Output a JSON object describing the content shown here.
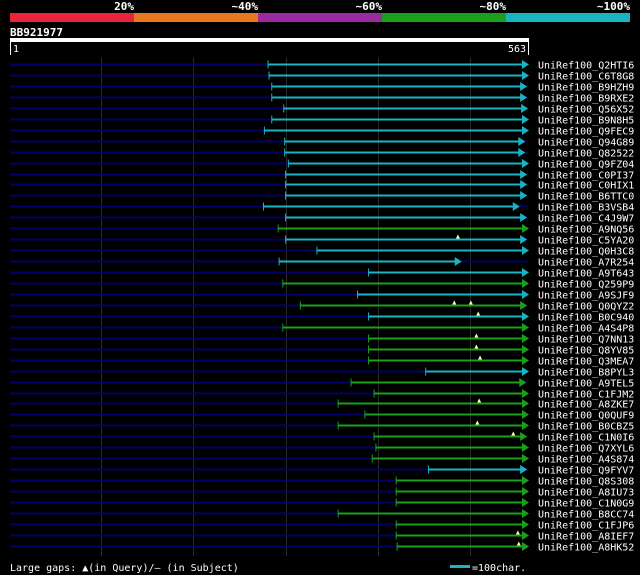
{
  "scale_labels": [
    "20%",
    "~40%",
    "~60%",
    "~80%",
    "~100%"
  ],
  "scale_colors": [
    "#e8243c",
    "#e8781e",
    "#9b2aa0",
    "#1aa01a",
    "#18b4c4"
  ],
  "query_name": "BB921977",
  "query_start": "1",
  "query_end": "563",
  "legend": {
    "gaps_text": "Large gaps: ▲(in Query)/– (in Subject)",
    "scale_text": "=100char."
  },
  "chart_data": {
    "type": "bar",
    "query_length": 563,
    "hits": [
      {
        "name": "UniRef100_Q2HTI6",
        "start": 281,
        "end": 563,
        "color": "#18b4c4",
        "query_gaps": []
      },
      {
        "name": "UniRef100_C6T8G8",
        "start": 282,
        "end": 563,
        "color": "#18b4c4",
        "query_gaps": []
      },
      {
        "name": "UniRef100_B9HZH9",
        "start": 285,
        "end": 561,
        "color": "#18b4c4",
        "query_gaps": []
      },
      {
        "name": "UniRef100_B9RXE2",
        "start": 285,
        "end": 561,
        "color": "#18b4c4",
        "query_gaps": []
      },
      {
        "name": "UniRef100_Q56X52",
        "start": 298,
        "end": 562,
        "color": "#18b4c4",
        "query_gaps": []
      },
      {
        "name": "UniRef100_B9N8H5",
        "start": 285,
        "end": 563,
        "color": "#18b4c4",
        "query_gaps": []
      },
      {
        "name": "UniRef100_Q9FEC9",
        "start": 277,
        "end": 563,
        "color": "#18b4c4",
        "query_gaps": []
      },
      {
        "name": "UniRef100_Q94G89",
        "start": 299,
        "end": 559,
        "color": "#18b4c4",
        "query_gaps": []
      },
      {
        "name": "UniRef100_Q82522",
        "start": 299,
        "end": 559,
        "color": "#18b4c4",
        "query_gaps": []
      },
      {
        "name": "UniRef100_Q9FZ04",
        "start": 303,
        "end": 563,
        "color": "#18b4c4",
        "query_gaps": []
      },
      {
        "name": "UniRef100_C0PI37",
        "start": 300,
        "end": 561,
        "color": "#18b4c4",
        "query_gaps": []
      },
      {
        "name": "UniRef100_C0HIX1",
        "start": 300,
        "end": 561,
        "color": "#18b4c4",
        "query_gaps": []
      },
      {
        "name": "UniRef100_B6TTC0",
        "start": 300,
        "end": 561,
        "color": "#18b4c4",
        "query_gaps": []
      },
      {
        "name": "UniRef100_B3VSB4",
        "start": 276,
        "end": 553,
        "color": "#18b4c4",
        "query_gaps": []
      },
      {
        "name": "UniRef100_C4J9W7",
        "start": 300,
        "end": 561,
        "color": "#18b4c4",
        "query_gaps": []
      },
      {
        "name": "UniRef100_A9NQ56",
        "start": 292,
        "end": 563,
        "color": "#1aa01a",
        "query_gaps": []
      },
      {
        "name": "UniRef100_C5YA20",
        "start": 300,
        "end": 561,
        "color": "#18b4c4",
        "query_gaps": [
          487
        ]
      },
      {
        "name": "UniRef100_Q0H3C8",
        "start": 334,
        "end": 563,
        "color": "#18b4c4",
        "query_gaps": []
      },
      {
        "name": "UniRef100_A7R254",
        "start": 293,
        "end": 490,
        "color": "#18b4c4",
        "query_gaps": []
      },
      {
        "name": "UniRef100_A9T643",
        "start": 390,
        "end": 563,
        "color": "#18b4c4",
        "query_gaps": []
      },
      {
        "name": "UniRef100_Q259P9",
        "start": 297,
        "end": 563,
        "color": "#1aa01a",
        "query_gaps": []
      },
      {
        "name": "UniRef100_A9SJF9",
        "start": 378,
        "end": 563,
        "color": "#18b4c4",
        "query_gaps": []
      },
      {
        "name": "UniRef100_Q0QYZ2",
        "start": 316,
        "end": 561,
        "color": "#1aa01a",
        "query_gaps": [
          483,
          501
        ]
      },
      {
        "name": "UniRef100_B0C940",
        "start": 390,
        "end": 563,
        "color": "#18b4c4",
        "query_gaps": [
          509
        ]
      },
      {
        "name": "UniRef100_A4S4P8",
        "start": 297,
        "end": 563,
        "color": "#1aa01a",
        "query_gaps": []
      },
      {
        "name": "UniRef100_Q7NN13",
        "start": 390,
        "end": 563,
        "color": "#1aa01a",
        "query_gaps": [
          507
        ]
      },
      {
        "name": "UniRef100_Q8YV85",
        "start": 390,
        "end": 563,
        "color": "#1aa01a",
        "query_gaps": [
          507
        ]
      },
      {
        "name": "UniRef100_Q3MEA7",
        "start": 390,
        "end": 563,
        "color": "#1aa01a",
        "query_gaps": [
          511
        ]
      },
      {
        "name": "UniRef100_B8PYL3",
        "start": 452,
        "end": 563,
        "color": "#18b4c4",
        "query_gaps": []
      },
      {
        "name": "UniRef100_A9TEL5",
        "start": 371,
        "end": 560,
        "color": "#1aa01a",
        "query_gaps": []
      },
      {
        "name": "UniRef100_C1FJM2",
        "start": 396,
        "end": 563,
        "color": "#1aa01a",
        "query_gaps": []
      },
      {
        "name": "UniRef100_A8ZKE7",
        "start": 357,
        "end": 563,
        "color": "#1aa01a",
        "query_gaps": [
          510
        ]
      },
      {
        "name": "UniRef100_Q0QUF9",
        "start": 386,
        "end": 563,
        "color": "#1aa01a",
        "query_gaps": []
      },
      {
        "name": "UniRef100_B0CBZ5",
        "start": 357,
        "end": 563,
        "color": "#1aa01a",
        "query_gaps": [
          508
        ]
      },
      {
        "name": "UniRef100_C1N0I6",
        "start": 396,
        "end": 561,
        "color": "#1aa01a",
        "query_gaps": [
          547
        ]
      },
      {
        "name": "UniRef100_Q7XYL6",
        "start": 398,
        "end": 563,
        "color": "#1aa01a",
        "query_gaps": []
      },
      {
        "name": "UniRef100_A4S874",
        "start": 394,
        "end": 563,
        "color": "#1aa01a",
        "query_gaps": []
      },
      {
        "name": "UniRef100_Q9FYV7",
        "start": 455,
        "end": 561,
        "color": "#18b4c4",
        "query_gaps": []
      },
      {
        "name": "UniRef100_Q8S308",
        "start": 420,
        "end": 563,
        "color": "#1aa01a",
        "query_gaps": []
      },
      {
        "name": "UniRef100_A8IU73",
        "start": 420,
        "end": 563,
        "color": "#1aa01a",
        "query_gaps": []
      },
      {
        "name": "UniRef100_C1N0G9",
        "start": 420,
        "end": 563,
        "color": "#1aa01a",
        "query_gaps": []
      },
      {
        "name": "UniRef100_B8CC74",
        "start": 357,
        "end": 563,
        "color": "#1aa01a",
        "query_gaps": []
      },
      {
        "name": "UniRef100_C1FJP6",
        "start": 420,
        "end": 563,
        "color": "#1aa01a",
        "query_gaps": []
      },
      {
        "name": "UniRef100_A8IEF7",
        "start": 420,
        "end": 563,
        "color": "#1aa01a",
        "query_gaps": [
          552
        ]
      },
      {
        "name": "UniRef100_A8HK52",
        "start": 421,
        "end": 563,
        "color": "#1aa01a",
        "query_gaps": [
          553
        ]
      }
    ]
  }
}
